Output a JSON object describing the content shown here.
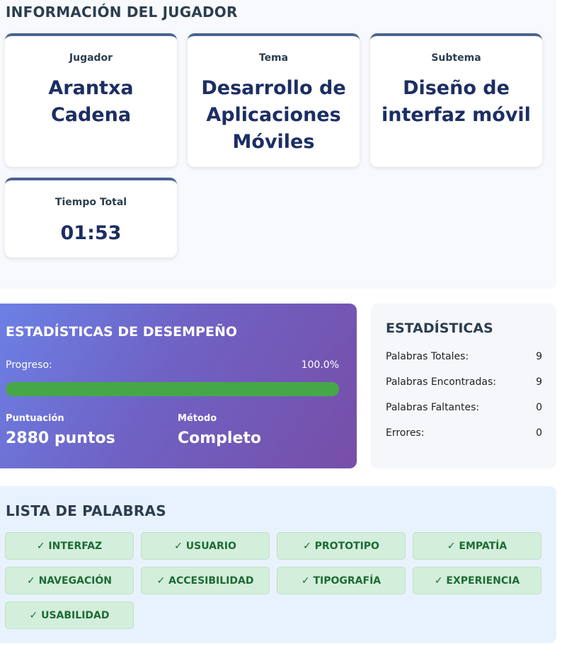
{
  "info": {
    "title": "INFORMACIÓN DEL JUGADOR",
    "cards": [
      {
        "label": "Jugador",
        "value": "Arantxa Cadena"
      },
      {
        "label": "Tema",
        "value": "Desarrollo de Aplicaciones Móviles"
      },
      {
        "label": "Subtema",
        "value": "Diseño de interfaz móvil"
      },
      {
        "label": "Tiempo Total",
        "value": "01:53"
      }
    ],
    "card_accent": "#4a6491"
  },
  "performance": {
    "title": "ESTADÍSTICAS DE DESEMPEÑO",
    "progress_label": "Progreso:",
    "progress_text": "100.0%",
    "progress_fraction": 1.0,
    "score_label": "Puntuación",
    "score_value": "2880 puntos",
    "method_label": "Método",
    "method_value": "Completo",
    "gradient_start": "#6c80e5",
    "gradient_end": "#774ea8",
    "progress_color": "#46a749"
  },
  "stats": {
    "title": "ESTADÍSTICAS",
    "rows": [
      {
        "label": "Palabras Totales:",
        "value": "9"
      },
      {
        "label": "Palabras Encontradas:",
        "value": "9"
      },
      {
        "label": "Palabras Faltantes:",
        "value": "0"
      },
      {
        "label": "Errores:",
        "value": "0"
      }
    ]
  },
  "words": {
    "title": "LISTA DE PALABRAS",
    "items": [
      "✓ INTERFAZ",
      "✓ USUARIO",
      "✓ PROTOTIPO",
      "✓ EMPATÍA",
      "✓ NAVEGACIÓN",
      "✓ ACCESIBILIDAD",
      "✓ TIPOGRAFÍA",
      "✓ EXPERIENCIA",
      "✓ USABILIDAD"
    ],
    "chip_color": "#d3eedb",
    "chip_text_color": "#1e6b34"
  }
}
